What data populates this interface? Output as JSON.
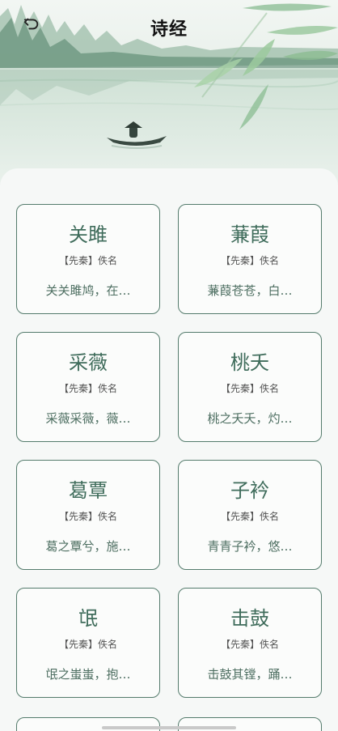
{
  "header": {
    "title": "诗经",
    "back_icon": "back-arrow-icon"
  },
  "poems": [
    {
      "title": "关雎",
      "meta": "【先秦】佚名",
      "snippet": "关关雎鸠，在…"
    },
    {
      "title": "蒹葭",
      "meta": "【先秦】佚名",
      "snippet": "蒹葭苍苍，白…"
    },
    {
      "title": "采薇",
      "meta": "【先秦】佚名",
      "snippet": "采薇采薇，薇…"
    },
    {
      "title": "桃夭",
      "meta": "【先秦】佚名",
      "snippet": "桃之夭夭，灼…"
    },
    {
      "title": "葛覃",
      "meta": "【先秦】佚名",
      "snippet": "葛之覃兮，施…"
    },
    {
      "title": "子衿",
      "meta": "【先秦】佚名",
      "snippet": "青青子衿，悠…"
    },
    {
      "title": "氓",
      "meta": "【先秦】佚名",
      "snippet": "氓之蚩蚩，抱…"
    },
    {
      "title": "击鼓",
      "meta": "【先秦】佚名",
      "snippet": "击鼓其镗，踊…"
    }
  ],
  "colors": {
    "accent": "#3f6c5b",
    "border": "#547b6c"
  }
}
